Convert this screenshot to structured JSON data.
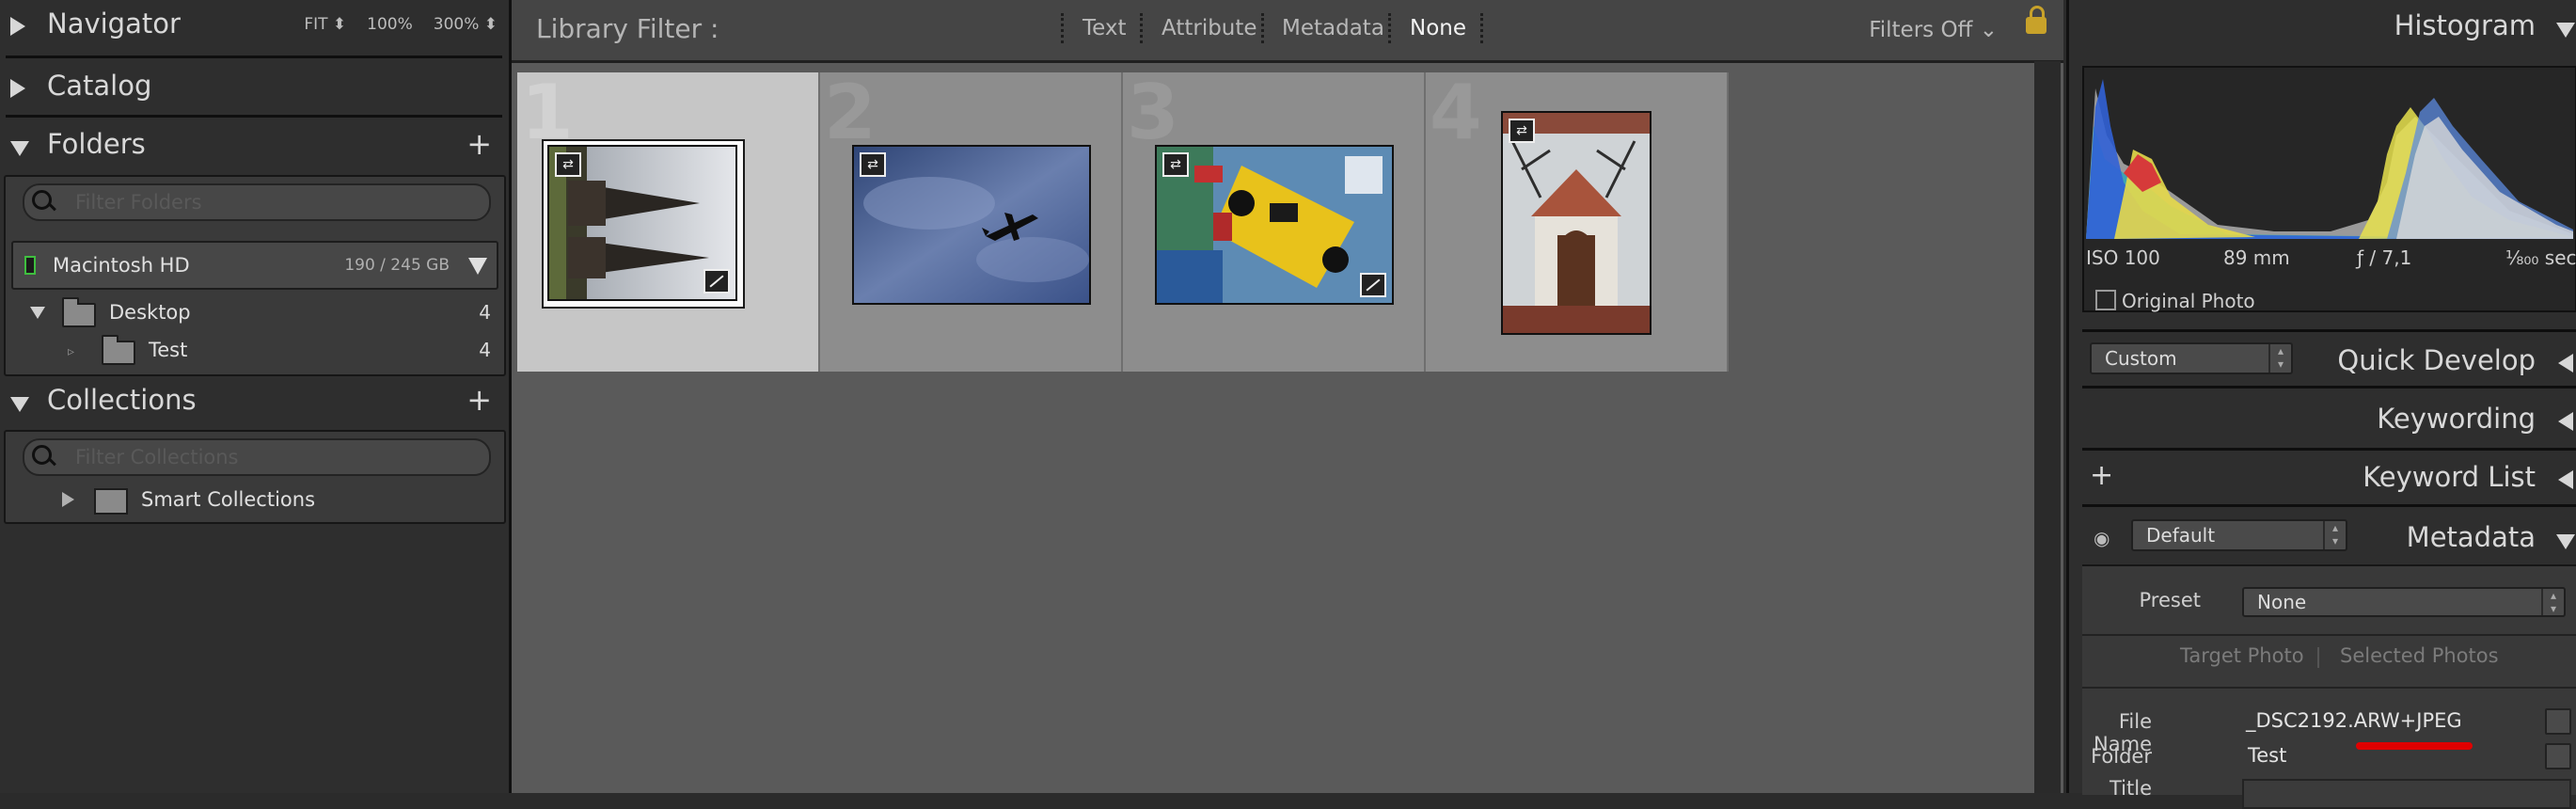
{
  "left": {
    "navigator": {
      "title": "Navigator",
      "options": [
        "FIT ⬍",
        "100%",
        "300% ⬍"
      ]
    },
    "catalog": {
      "title": "Catalog"
    },
    "folders": {
      "title": "Folders",
      "plus": "+",
      "filter_placeholder": "Filter Folders",
      "volume": {
        "name": "Macintosh HD",
        "size": "190 / 245 GB"
      },
      "items": [
        {
          "name": "Desktop",
          "count": "4"
        },
        {
          "name": "Test",
          "count": "4"
        }
      ]
    },
    "collections": {
      "title": "Collections",
      "plus": "+",
      "filter_placeholder": "Filter Collections",
      "items": [
        {
          "name": "Smart Collections"
        }
      ]
    }
  },
  "center": {
    "filterbar": {
      "label": "Library Filter :",
      "options": [
        "Text",
        "Attribute",
        "Metadata",
        "None"
      ],
      "active": "None",
      "filters_off": "Filters Off ⌄"
    },
    "grid": {
      "cells": [
        {
          "index": "1",
          "subject": "church towers",
          "selected": true
        },
        {
          "index": "2",
          "subject": "airplane in sky",
          "selected": false
        },
        {
          "index": "3",
          "subject": "yellow race car",
          "selected": false
        },
        {
          "index": "4",
          "subject": "building entrance",
          "selected": false
        }
      ]
    }
  },
  "right": {
    "histogram": {
      "title": "Histogram",
      "iso": "ISO 100",
      "focal": "89 mm",
      "aperture": "ƒ / 7,1",
      "shutter": "¹⁄₈₀₀ sec",
      "original_photo": "Original Photo"
    },
    "quick_develop": {
      "title": "Quick Develop",
      "preset": "Custom"
    },
    "keywording": {
      "title": "Keywording"
    },
    "keyword_list": {
      "title": "Keyword List",
      "plus": "+"
    },
    "metadata": {
      "title": "Metadata",
      "preset_select": "Default",
      "preset_label": "Preset",
      "preset_value": "None",
      "tabs": [
        "Target Photo",
        "Selected Photos"
      ],
      "fields": [
        {
          "label": "File Name",
          "value": "_DSC2192.ARW+JPEG"
        },
        {
          "label": "Folder",
          "value": "Test"
        },
        {
          "label": "Title",
          "value": ""
        }
      ]
    }
  },
  "colors": {
    "accent_red": "#e00000",
    "lock": "#c8a22a"
  }
}
